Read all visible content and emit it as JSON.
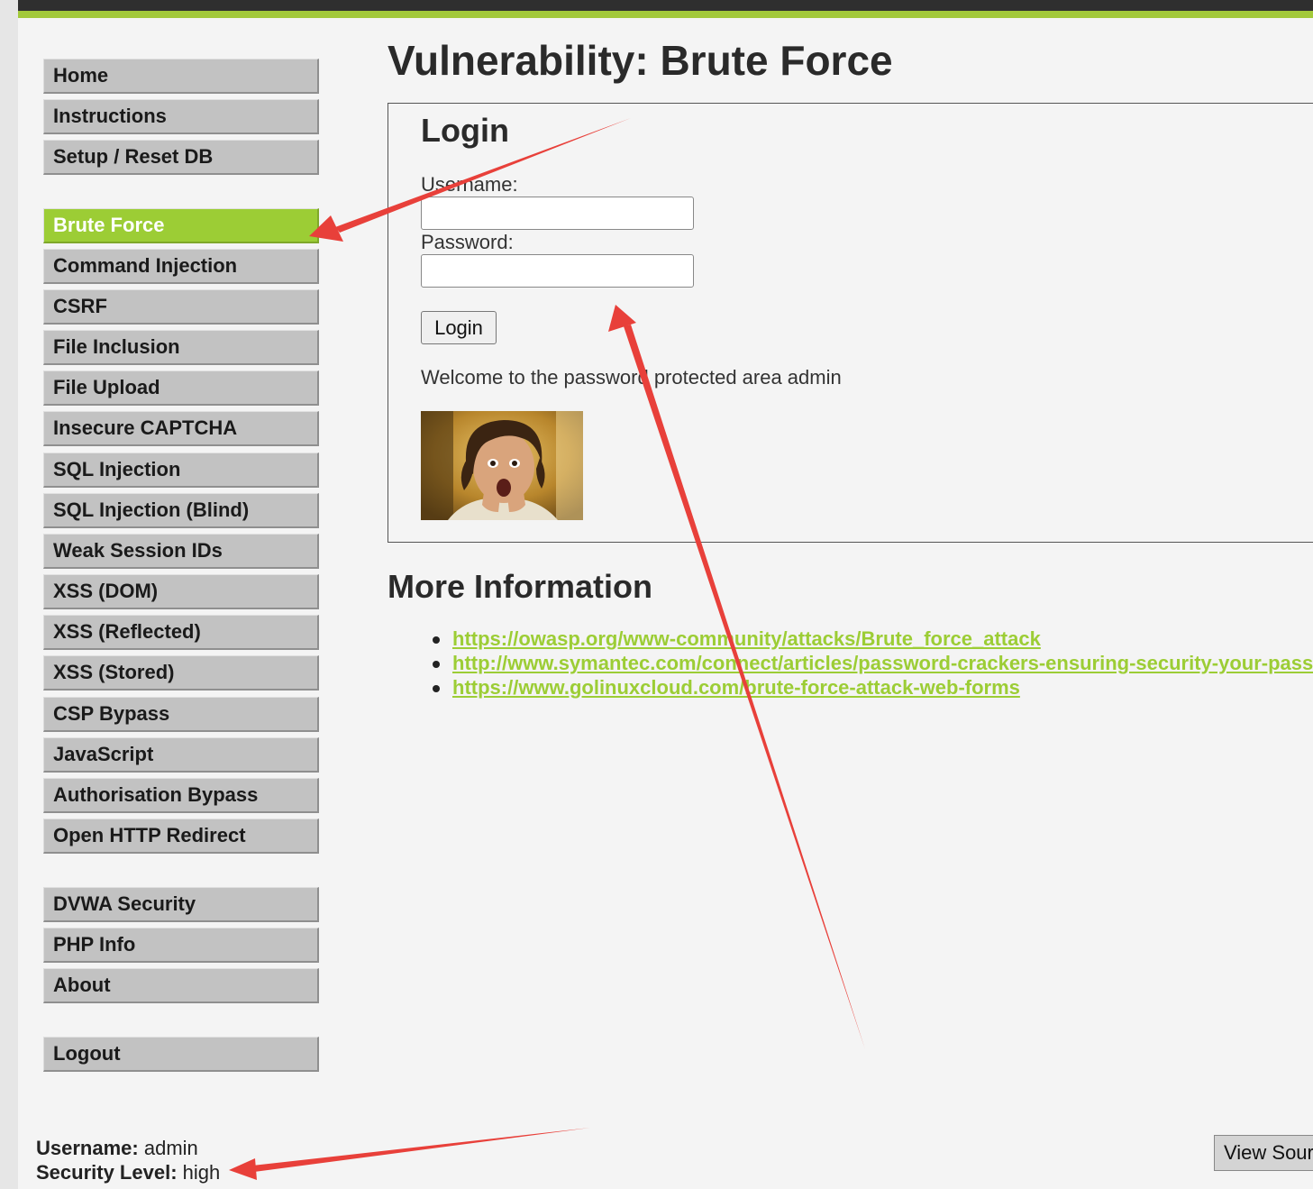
{
  "page": {
    "title": "Vulnerability: Brute Force"
  },
  "sidebar": {
    "groups": [
      [
        "Home",
        "Instructions",
        "Setup / Reset DB"
      ],
      [
        "Brute Force",
        "Command Injection",
        "CSRF",
        "File Inclusion",
        "File Upload",
        "Insecure CAPTCHA",
        "SQL Injection",
        "SQL Injection (Blind)",
        "Weak Session IDs",
        "XSS (DOM)",
        "XSS (Reflected)",
        "XSS (Stored)",
        "CSP Bypass",
        "JavaScript",
        "Authorisation Bypass",
        "Open HTTP Redirect"
      ],
      [
        "DVWA Security",
        "PHP Info",
        "About"
      ],
      [
        "Logout"
      ]
    ],
    "selected": "Brute Force"
  },
  "login": {
    "heading": "Login",
    "username_label": "Username:",
    "username_value": "",
    "password_label": "Password:",
    "password_value": "",
    "button_label": "Login",
    "welcome_message": "Welcome to the password protected area admin"
  },
  "more_info": {
    "heading": "More Information",
    "links": [
      "https://owasp.org/www-community/attacks/Brute_force_attack",
      "http://www.symantec.com/connect/articles/password-crackers-ensuring-security-your-password",
      "https://www.golinuxcloud.com/brute-force-attack-web-forms"
    ]
  },
  "footer": {
    "username_label": "Username:",
    "username_value": "admin",
    "security_label": "Security Level:",
    "security_value": "high",
    "view_source_label": "View Source"
  },
  "colors": {
    "accent": "#9ccd35",
    "header_bar": "#2f2f2f",
    "menu_item": "#c2c2c2",
    "annotation_arrow": "#e8403a"
  },
  "icons": {
    "avatar_photo": "surprised-person-photo"
  }
}
